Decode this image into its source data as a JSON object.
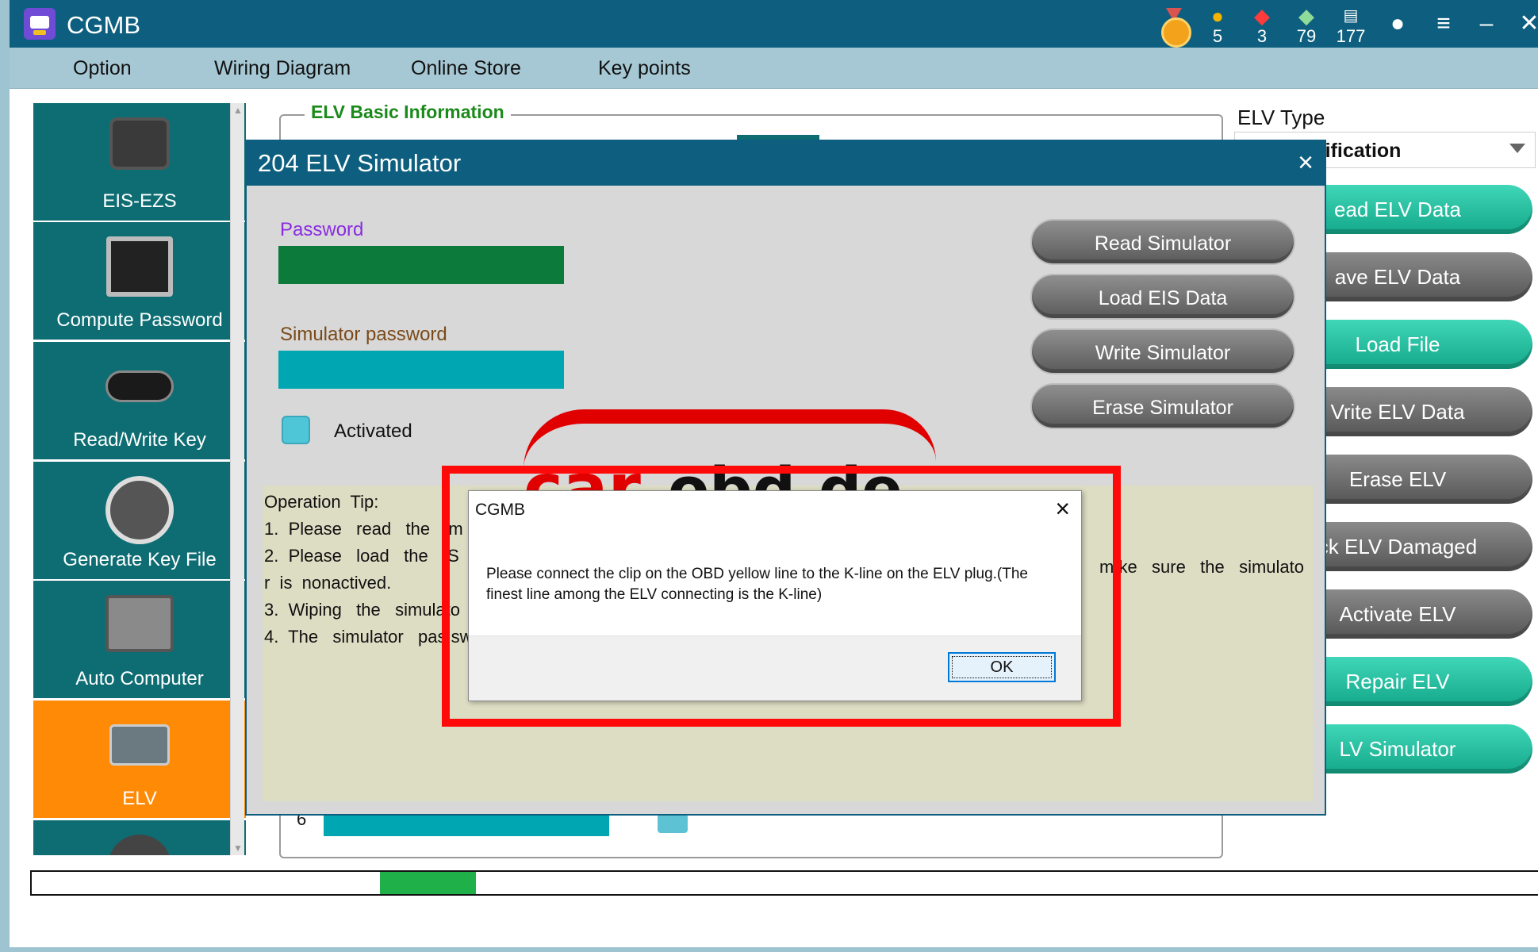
{
  "app": {
    "title": "CGMB"
  },
  "title_stats": {
    "coins": "5",
    "rubies": "3",
    "gems": "79",
    "points": "177"
  },
  "menu": [
    "Option",
    "Wiring Diagram",
    "Online Store",
    "Key points"
  ],
  "sidebar": [
    {
      "label": "EIS-EZS",
      "icon": "ignition-switch-icon"
    },
    {
      "label": "Compute Password",
      "icon": "chip-icon"
    },
    {
      "label": "Read/Write Key",
      "icon": "car-key-icon"
    },
    {
      "label": "Generate Key File",
      "icon": "printer-icon"
    },
    {
      "label": "Auto Computer",
      "icon": "ecu-icon"
    },
    {
      "label": "ELV",
      "icon": "elv-module-icon",
      "active": true
    }
  ],
  "basic_info": {
    "title": "ELV Basic Information",
    "bottom_number": "6"
  },
  "elv_type": {
    "label": "ELV Type",
    "value": "ntification"
  },
  "right_buttons": [
    {
      "label": "ead ELV Data",
      "style": "teal"
    },
    {
      "label": "ave ELV Data",
      "style": "gray"
    },
    {
      "label": "Load File",
      "style": "teal"
    },
    {
      "label": "Vrite ELV Data",
      "style": "gray"
    },
    {
      "label": "Erase ELV",
      "style": "gray"
    },
    {
      "label": "ck ELV Damaged",
      "style": "gray"
    },
    {
      "label": "Activate ELV",
      "style": "gray"
    },
    {
      "label": "Repair ELV",
      "style": "teal"
    },
    {
      "label": "LV Simulator",
      "style": "teal"
    }
  ],
  "progress": {
    "fraction": 0.064,
    "start": 0.231
  },
  "simulator": {
    "title": "204 ELV Simulator",
    "close": "×",
    "password_label": "Password",
    "simulator_password_label": "Simulator password",
    "activated_label": "Activated",
    "buttons": [
      "Read Simulator",
      "Load EIS Data",
      "Write Simulator",
      "Erase Simulator"
    ],
    "tips": [
      "Operation  Tip:",
      "1.  Please   read   the   im",
      "2.  Please   load   the   IS",
      "r  is  nonactived.",
      "3.  Wiping   the   simulato",
      "4.  The   simulator   pas sw"
    ],
    "tip_right": "m ke   sure   the   simulato"
  },
  "watermark": {
    "part1": "car",
    "part2": "obd.de"
  },
  "message_box": {
    "title": "CGMB",
    "close": "×",
    "text": "Please connect the clip on the OBD yellow line to the K-line on the ELV plug.(The finest line among the ELV connecting is the K-line)",
    "ok": "OK"
  },
  "colors": {
    "titlebar": "#0e5f7f",
    "sidebar": "#0e6d73",
    "sidebar_active": "#ff8a05",
    "highlight": "#ff0a0a",
    "progress": "#1fb04a"
  }
}
